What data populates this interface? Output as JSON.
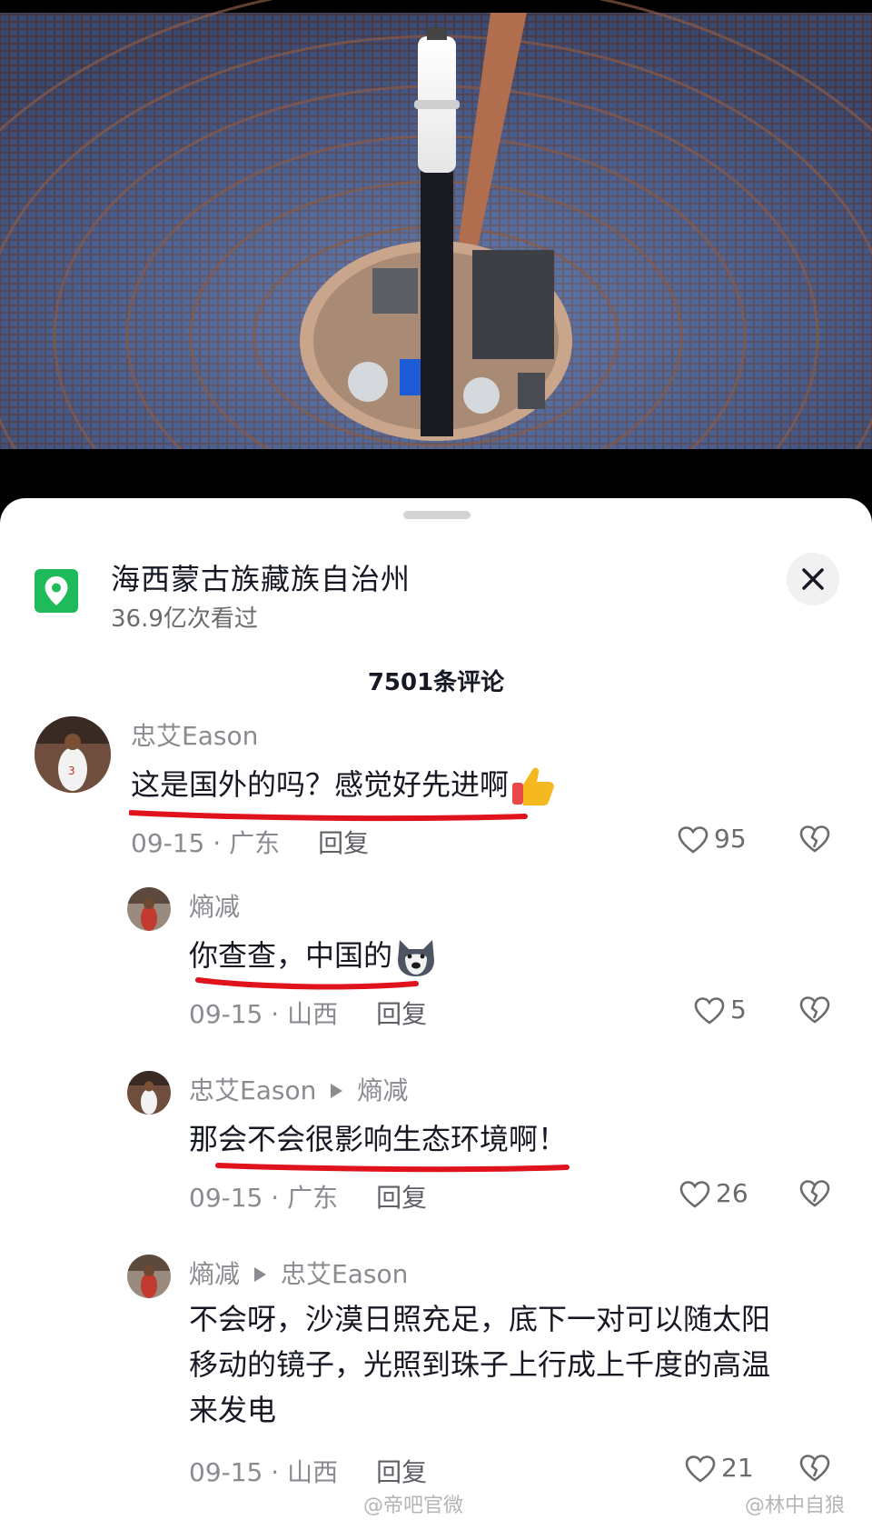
{
  "location": {
    "icon": "location-pin-icon",
    "title": "海西蒙古族藏族自治州",
    "views": "36.9亿次看过"
  },
  "comment_count": "7501条评论",
  "comments": [
    {
      "user": "忠艾Eason",
      "text": "这是国外的吗？感觉好先进啊",
      "emoji": "thumbs-up-icon",
      "date": "09-15",
      "region": "广东",
      "reply": "回复",
      "likes": "95"
    },
    {
      "user": "熵减",
      "text": "你查查，中国的",
      "emoji": "dog-face-icon",
      "date": "09-15",
      "region": "山西",
      "reply": "回复",
      "likes": "5"
    },
    {
      "user": "忠艾Eason",
      "reply_to": "熵减",
      "text": "那会不会很影响生态环境啊！",
      "date": "09-15",
      "region": "广东",
      "reply": "回复",
      "likes": "26"
    },
    {
      "user": "熵减",
      "reply_to": "忠艾Eason",
      "text_lines": [
        "不会呀，沙漠日照充足，底下一对可以随太阳",
        "移动的镜子，光照到珠子上行成上千度的高温",
        "来发电"
      ],
      "date": "09-15",
      "region": "山西",
      "reply": "回复",
      "likes": "21"
    }
  ],
  "separator": "·",
  "watermarks": [
    "@帝吧官微",
    "@林中自狼"
  ],
  "colors": {
    "accent_green": "#1fba5a",
    "underline_red": "#e0121b",
    "muted": "#8a8b91"
  }
}
